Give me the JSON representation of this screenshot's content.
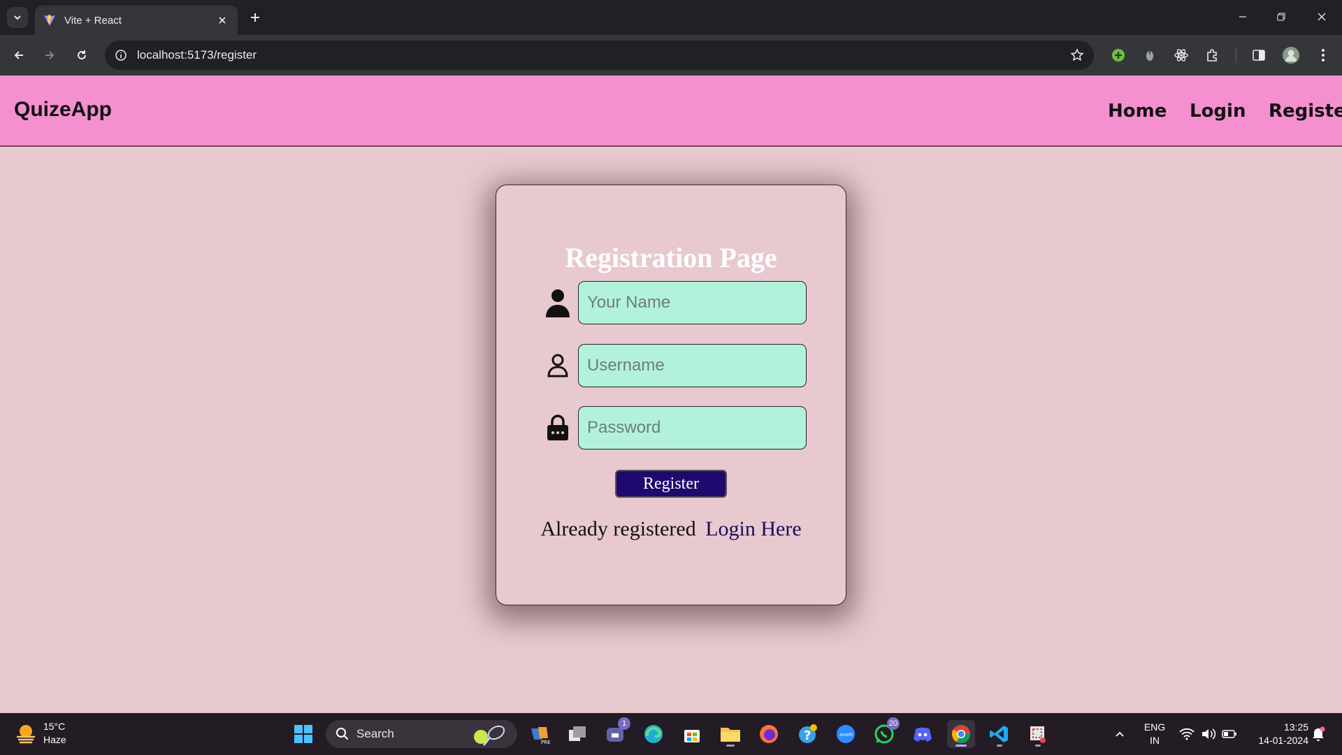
{
  "browser": {
    "tab_title": "Vite + React",
    "url": "localhost:5173/register"
  },
  "navbar": {
    "brand": "QuizeApp",
    "links": [
      "Home",
      "Login",
      "Register"
    ]
  },
  "form": {
    "title": "Registration Page",
    "name_placeholder": "Your Name",
    "username_placeholder": "Username",
    "password_placeholder": "Password",
    "submit_label": "Register",
    "footer_text": "Already registered",
    "footer_link": "Login Here"
  },
  "taskbar": {
    "temperature": "15°C",
    "weather": "Haze",
    "search_label": "Search",
    "teams_badge": "1",
    "whatsapp_badge": "20",
    "lang_top": "ENG",
    "lang_bottom": "IN",
    "time": "13:25",
    "date": "14-01-2024"
  },
  "colors": {
    "page_bg": "#e8c9cf",
    "navbar_bg": "#f48fd0",
    "input_bg": "#b2f2dd",
    "button_bg": "#1e0a6e"
  }
}
